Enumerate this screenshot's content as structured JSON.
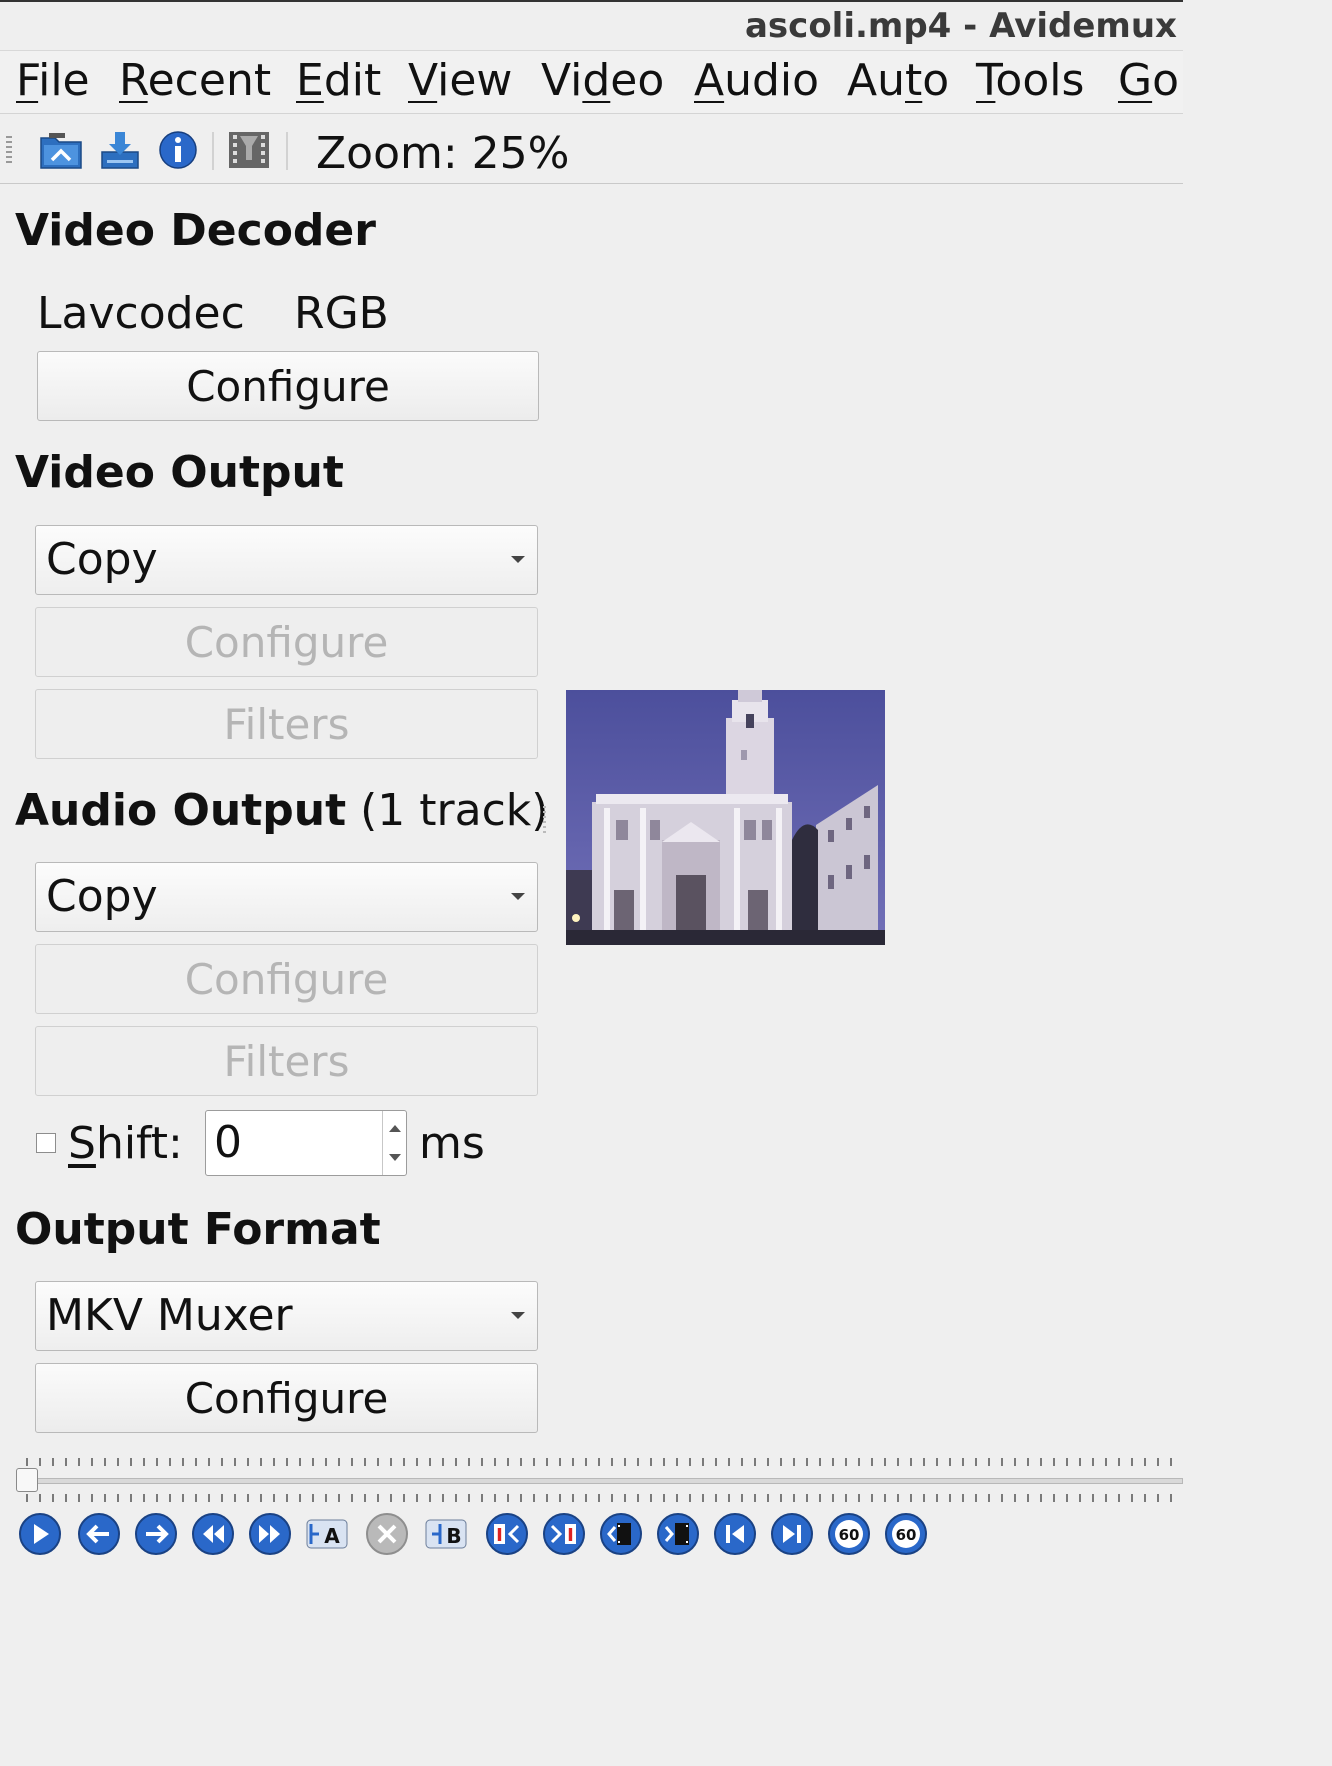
{
  "window": {
    "title": "ascoli.mp4 - Avidemux"
  },
  "menu": {
    "items": [
      {
        "pre": "",
        "ul": "F",
        "post": "ile"
      },
      {
        "pre": "",
        "ul": "R",
        "post": "ecent"
      },
      {
        "pre": "",
        "ul": "E",
        "post": "dit"
      },
      {
        "pre": "",
        "ul": "V",
        "post": "iew"
      },
      {
        "pre": "Vi",
        "ul": "d",
        "post": "eo"
      },
      {
        "pre": "",
        "ul": "A",
        "post": "udio"
      },
      {
        "pre": "Au",
        "ul": "t",
        "post": "o"
      },
      {
        "pre": "",
        "ul": "T",
        "post": "ools"
      },
      {
        "pre": "",
        "ul": "G",
        "post": "o"
      }
    ]
  },
  "toolbar": {
    "icons": [
      "open-video-icon",
      "save-video-icon",
      "properties-icon",
      "filmstrip-icon"
    ],
    "zoom_label": "Zoom: 25%"
  },
  "video_decoder": {
    "heading": "Video Decoder",
    "codec": "Lavcodec",
    "format": "RGB",
    "configure_label": "Configure"
  },
  "video_output": {
    "heading": "Video Output",
    "selected": "Copy",
    "configure_label": "Configure",
    "filters_label": "Filters"
  },
  "audio_output": {
    "heading": "Audio Output",
    "track_info": " (1 track)",
    "selected": "Copy",
    "configure_label": "Configure",
    "filters_label": "Filters",
    "shift_pre": "",
    "shift_ul": "S",
    "shift_post": "hift:",
    "shift_value": "0",
    "shift_unit": "ms"
  },
  "output_format": {
    "heading": "Output Format",
    "selected": "MKV Muxer",
    "configure_label": "Configure"
  },
  "navigation": {
    "position": 0,
    "icons": [
      "play-icon",
      "previous-frame-icon",
      "next-frame-icon",
      "rewind-icon",
      "fast-forward-icon",
      "set-marker-a-icon",
      "delete-selection-icon",
      "set-marker-b-icon",
      "previous-cut-icon",
      "next-cut-icon",
      "previous-keyframe-icon",
      "next-keyframe-icon",
      "go-to-start-icon",
      "go-to-end-icon",
      "back-60-icon",
      "forward-60-icon"
    ],
    "marker_a": "A",
    "marker_b": "B",
    "cut_mark": "I",
    "jump_back": "60",
    "jump_forward": "60"
  },
  "colors": {
    "nav_blue": "#2a68c9",
    "disabled_text": "#b5b5b5",
    "sky": "#5a5ea8"
  }
}
